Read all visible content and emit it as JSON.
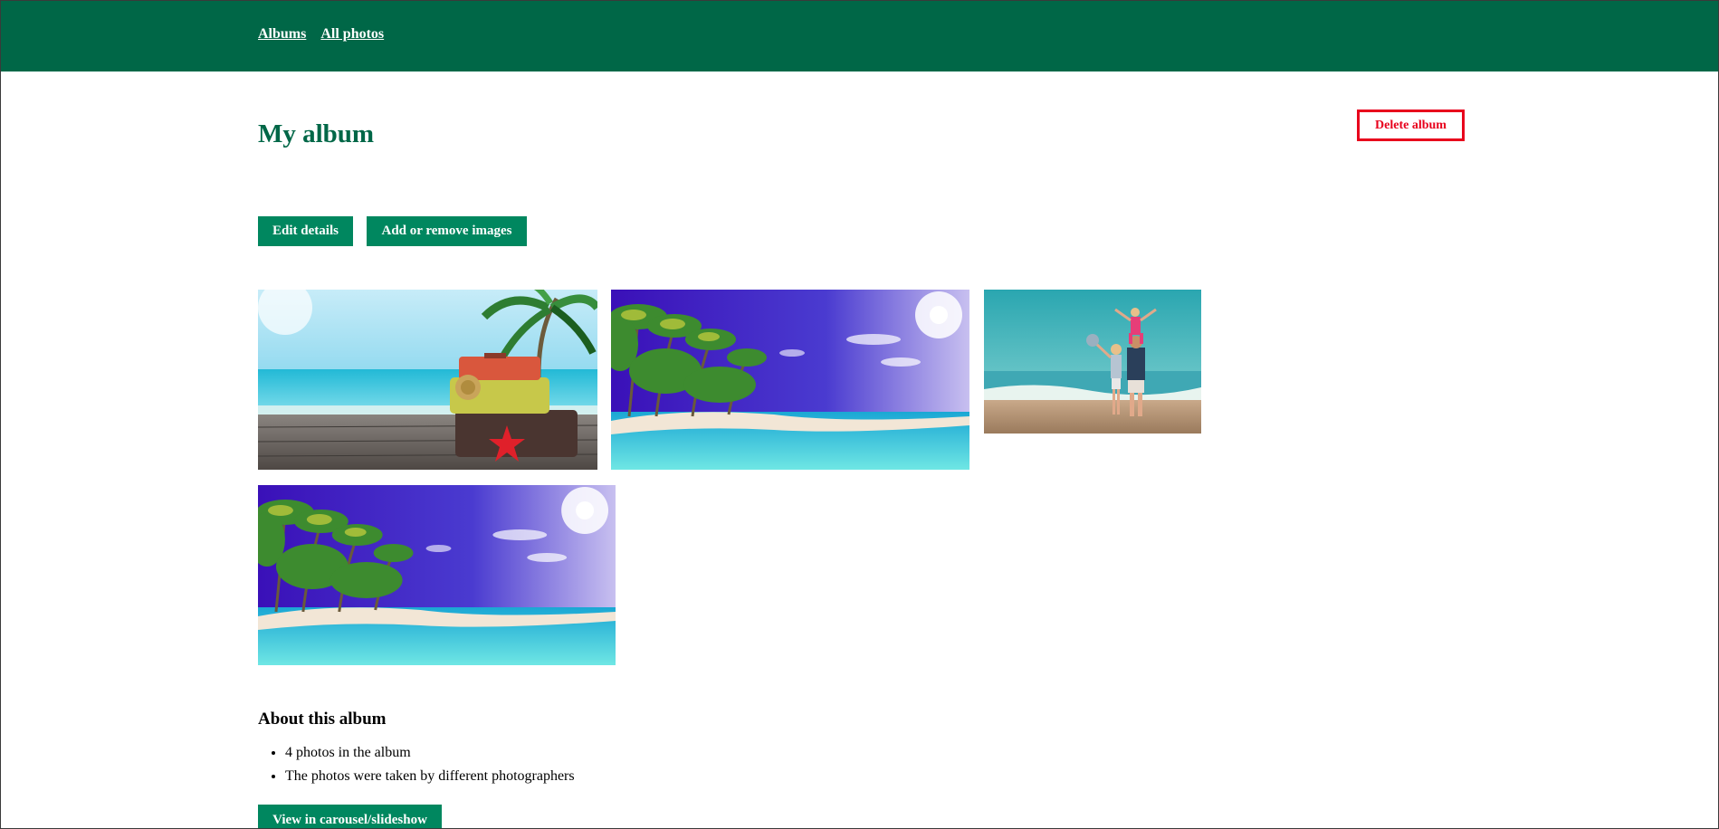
{
  "nav": {
    "albums_label": "Albums",
    "all_photos_label": "All photos"
  },
  "album": {
    "title": "My album",
    "delete_label": "Delete album",
    "edit_label": "Edit details",
    "add_remove_label": "Add or remove images"
  },
  "photos": [
    {
      "name": "photo-suitcases-beach"
    },
    {
      "name": "photo-tropical-beach-palms"
    },
    {
      "name": "photo-family-at-beach"
    },
    {
      "name": "photo-tropical-beach-palms-2"
    }
  ],
  "about": {
    "heading": "About this album",
    "items": [
      "4 photos in the album",
      "The photos were taken by different photographers"
    ]
  },
  "carousel_label": "View in carousel/slideshow",
  "colors": {
    "brand_green": "#006747",
    "button_green": "#00875f",
    "danger_red": "#e8001c"
  }
}
